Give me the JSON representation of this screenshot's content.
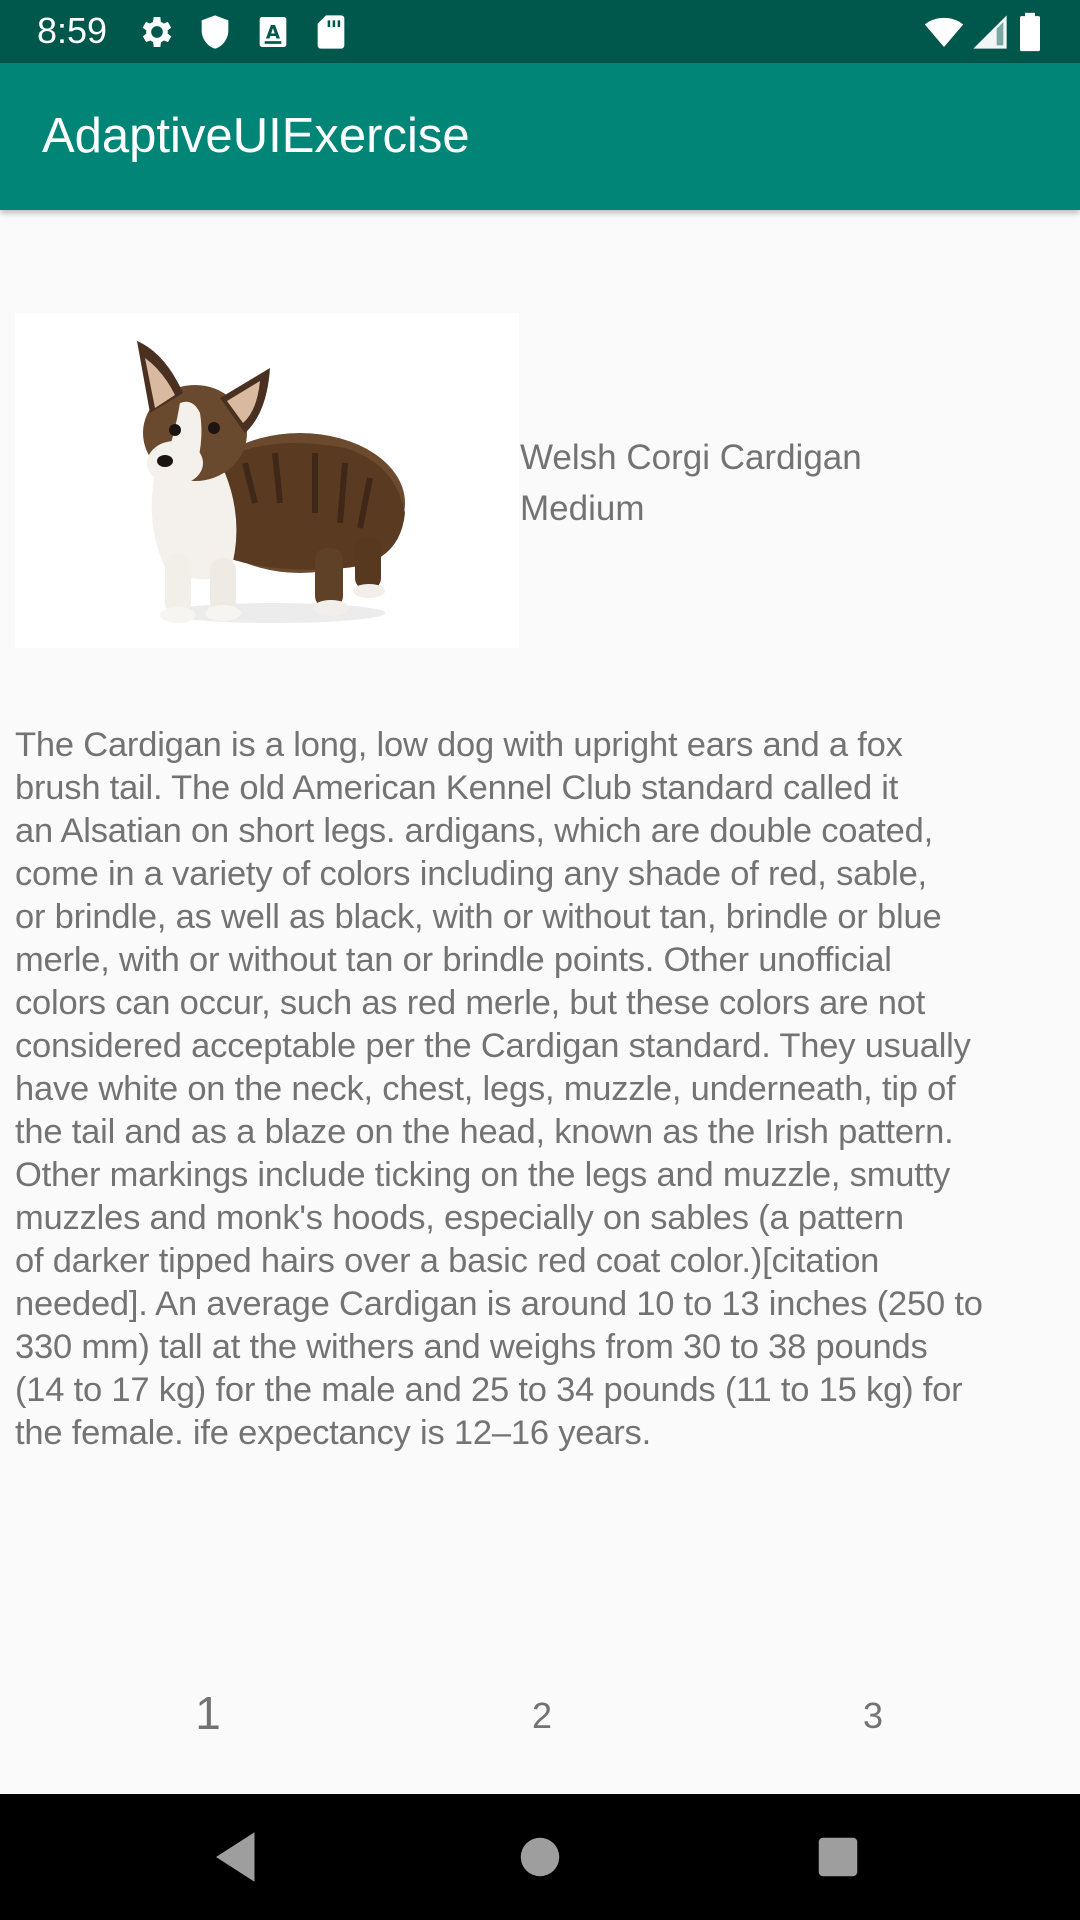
{
  "status_bar": {
    "time": "8:59",
    "left_icons": [
      "gear-icon",
      "shield-icon",
      "a-box-icon",
      "sd-card-icon"
    ],
    "right_icons": [
      "wifi-icon",
      "signal-icon",
      "battery-icon"
    ]
  },
  "app_bar": {
    "title": "AdaptiveUIExercise"
  },
  "dog": {
    "image": "corgi-image",
    "name": "Welsh Corgi Cardigan",
    "size": "Medium",
    "description_lines": [
      "The Cardigan is a long, low dog with upright ears and a fox",
      "brush tail. The old American Kennel Club standard called it",
      "an Alsatian on short legs. ardigans, which are double coated,",
      "come in a variety of colors including any shade of red, sable,",
      "or brindle, as well as black, with or without tan, brindle or blue",
      "merle, with or without tan or brindle points. Other unofficial",
      "colors can occur, such as red merle, but these colors are not",
      "considered acceptable per the Cardigan standard. They usually",
      "have white on the neck, chest, legs, muzzle, underneath, tip of",
      "the tail and as a blaze on the head, known as the Irish pattern.",
      "Other markings include ticking on the legs and muzzle, smutty",
      "muzzles and monk's hoods, especially on sables (a pattern",
      "of darker tipped hairs over a basic red coat color.)[citation",
      "needed]. An average Cardigan is around 10 to 13 inches (250 to",
      "330 mm) tall at the withers and weighs from 30 to 38 pounds",
      "(14 to 17 kg) for the male and 25 to 34 pounds (11 to 15 kg) for",
      "the female. ife expectancy is 12–16 years."
    ]
  },
  "pager": {
    "pages": [
      "1",
      "2",
      "3"
    ],
    "selected": "1"
  },
  "nav_bar": {
    "buttons": [
      "back-icon",
      "home-icon",
      "recents-icon"
    ]
  },
  "colors": {
    "status_bar": "#00574b",
    "app_bar": "#008577",
    "text": "#737373",
    "background": "#fafafa"
  }
}
